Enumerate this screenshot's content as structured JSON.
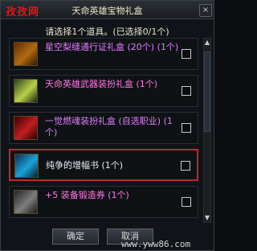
{
  "window": {
    "title": "天命英雄宝物礼盒",
    "watermark_top": "孜孜网",
    "instruction": "请选择1个道具。(已选择0/1个)",
    "close_label": "×"
  },
  "items": [
    {
      "label": "星空梨缝通行证礼盒 (20个) (1个)",
      "icon": "chest-icon",
      "checked": false
    },
    {
      "label": "天命英雄武器装扮礼盒 (1个)",
      "icon": "weapon-icon",
      "checked": false
    },
    {
      "label": "一觉燃魂装扮礼盒 (自选职业) (1个)",
      "icon": "armor-icon",
      "checked": false
    },
    {
      "label": "纯争的增幅书 (1个)",
      "icon": "book-icon",
      "checked": false,
      "selected": true
    },
    {
      "label": "+5 装备锻造券 (1个)",
      "icon": "ticket-icon",
      "checked": false
    }
  ],
  "footer": {
    "confirm_label": "确定",
    "cancel_label": "取消",
    "watermark_bottom": "www.yww86.com"
  }
}
